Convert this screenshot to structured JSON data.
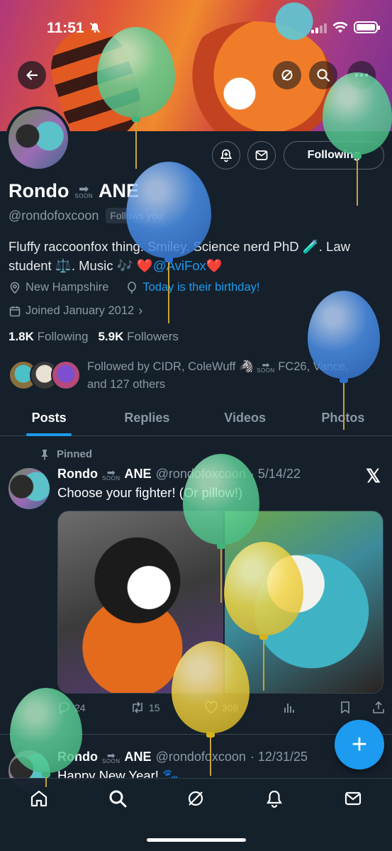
{
  "status_bar": {
    "time": "11:51"
  },
  "profile": {
    "display_name_first": "Rondo",
    "display_name_last": "ANE",
    "soon_badge": "SOON",
    "handle": "@rondofoxcoon",
    "follows_you": "Follows you",
    "bio_part1": "Fluffy raccoonfox thing. Smiley. Science nerd PhD 🧪. Law student ⚖️. Music 🎶 ❤️",
    "bio_link": "@AviFox",
    "bio_end": "❤️",
    "location": "New Hampshire",
    "birthday": "Today is their birthday!",
    "joined": "Joined January 2012",
    "following_count": "1.8K",
    "following_label": "Following",
    "followers_count": "5.9K",
    "followers_label": "Followers",
    "followed_by_1": "Followed by CIDR, ColeWuff 🦓",
    "followed_by_2": "FC26, Vance,",
    "followed_by_3": "and 127 others",
    "following_button": "Following"
  },
  "tabs": [
    "Posts",
    "Replies",
    "Videos",
    "Photos"
  ],
  "tweet1": {
    "pinned_label": "Pinned",
    "name_first": "Rondo",
    "name_last": "ANE",
    "handle": "@rondofoxcoon",
    "date": "· 5/14/22",
    "text": "Choose your fighter! (Or pillow!)",
    "replies": "24",
    "retweets": "15",
    "likes": "308"
  },
  "tweet2": {
    "name_first": "Rondo",
    "name_last": "ANE",
    "handle": "@rondofoxcoon",
    "date": "· 12/31/25",
    "text": "Happy New Year! 🐾"
  },
  "fab_label": "+",
  "x_logo": "𝕏",
  "colors": {
    "accent": "#1d9bf0",
    "background": "#15202b",
    "muted": "#8b98a5"
  }
}
